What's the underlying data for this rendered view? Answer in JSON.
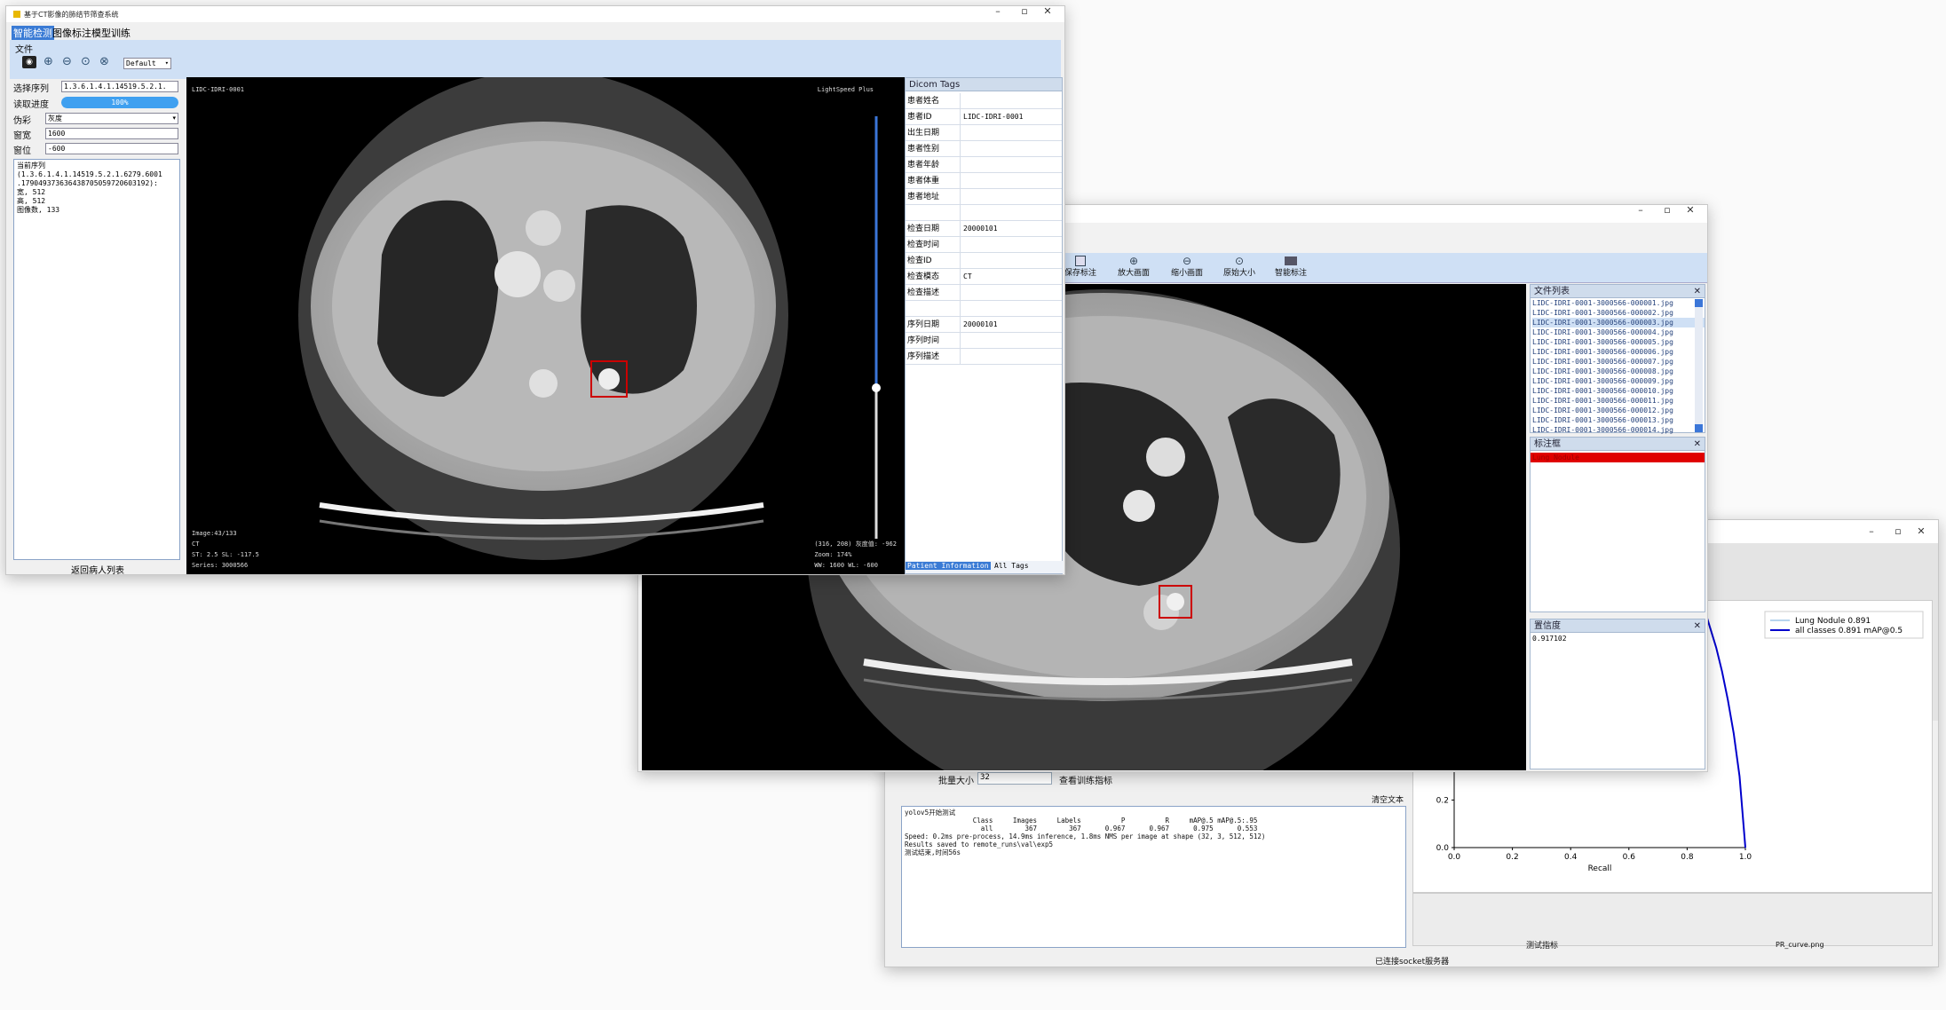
{
  "w1": {
    "title": "基于CT影像的肺结节筛查系统",
    "tabs": [
      "智能检测",
      "图像标注",
      "模型训练"
    ],
    "menu_file": "文件",
    "preset": "Default",
    "select_series_label": "选择序列",
    "select_series_value": "1.3.6.1.4.1.14519.5.2.1.",
    "progress_label": "读取进度",
    "progress_text": "100%",
    "progress_fraction": 1.0,
    "colormap_label": "伪彩",
    "colormap_value": "灰度",
    "ww_label": "窗宽",
    "ww_value": "1600",
    "wl_label": "窗位",
    "wl_value": "-600",
    "info_lines": [
      "当前序列",
      "(1.3.6.1.4.1.14519.5.2.1.6279.6001",
      ".179049373636438705059720603192):",
      "宽, 512",
      "高, 512",
      "图像数, 133"
    ],
    "back_button": "返回病人列表",
    "viewer": {
      "top_left": "LIDC-IDRI-0001",
      "top_right": "LightSpeed Plus",
      "bottom_left": [
        "Image:43/133",
        "CT",
        "ST: 2.5 SL: -117.5",
        "Series: 3000566"
      ],
      "bottom_right": [
        "(316, 208) 灰度值: -962",
        "Zoom: 174%",
        "WW: 1600 WL: -600"
      ]
    },
    "dicom_panel_title": "Dicom Tags",
    "dicom_rows": [
      [
        "患者姓名",
        ""
      ],
      [
        "患者ID",
        "LIDC-IDRI-0001"
      ],
      [
        "出生日期",
        ""
      ],
      [
        "患者性别",
        ""
      ],
      [
        "患者年龄",
        ""
      ],
      [
        "患者体重",
        ""
      ],
      [
        "患者地址",
        ""
      ],
      [
        "",
        ""
      ],
      [
        "检查日期",
        "20000101"
      ],
      [
        "检查时间",
        ""
      ],
      [
        "检查ID",
        ""
      ],
      [
        "检查模态",
        "CT"
      ],
      [
        "检查描述",
        ""
      ],
      [
        "",
        ""
      ],
      [
        "序列日期",
        "20000101"
      ],
      [
        "序列时间",
        ""
      ],
      [
        "序列描述",
        ""
      ]
    ],
    "bottom_tabs": [
      "Patient Information",
      "All Tags"
    ]
  },
  "w2": {
    "toolbar": [
      "保存标注",
      "放大画面",
      "缩小画面",
      "原始大小",
      "智能标注"
    ],
    "file_list_title": "文件列表",
    "files": [
      "LIDC-IDRI-0001-3000566-000001.jpg",
      "LIDC-IDRI-0001-3000566-000002.jpg",
      "LIDC-IDRI-0001-3000566-000003.jpg",
      "LIDC-IDRI-0001-3000566-000004.jpg",
      "LIDC-IDRI-0001-3000566-000005.jpg",
      "LIDC-IDRI-0001-3000566-000006.jpg",
      "LIDC-IDRI-0001-3000566-000007.jpg",
      "LIDC-IDRI-0001-3000566-000008.jpg",
      "LIDC-IDRI-0001-3000566-000009.jpg",
      "LIDC-IDRI-0001-3000566-000010.jpg",
      "LIDC-IDRI-0001-3000566-000011.jpg",
      "LIDC-IDRI-0001-3000566-000012.jpg",
      "LIDC-IDRI-0001-3000566-000013.jpg",
      "LIDC-IDRI-0001-3000566-000014.jpg"
    ],
    "selected_file_index": 2,
    "label_box_title": "标注框",
    "label_box_item": "Lung Nodule",
    "confidence_title": "置信度",
    "confidence_value": "0.917102"
  },
  "w3": {
    "batch_label": "批量大小",
    "batch_value": "32",
    "view_metrics_button": "查看训练指标",
    "clear_text_button": "清空文本",
    "log_lines": [
      "yolov5开始测试",
      "                 Class     Images     Labels          P          R     mAP@.5 mAP@.5:.95",
      "                   all        367        367      0.967      0.967      0.975      0.553",
      "Speed: 0.2ms pre-process, 14.9ms inference, 1.8ms NMS per image at shape (32, 3, 512, 512)",
      "Results saved to remote_runs\\val\\exp5",
      "测试结束,时间56s"
    ],
    "status_text": "已连接socket服务器",
    "bottom_tabs": [
      "测试指标",
      "PR_curve.png"
    ]
  },
  "chart_data": {
    "type": "line",
    "xlabel": "Recall",
    "ylabel": "",
    "xlim": [
      0.0,
      1.0
    ],
    "x_ticks": [
      "0.0",
      "0.2",
      "0.4",
      "0.6",
      "0.8",
      "1.0"
    ],
    "y_ticks": [
      "0.0",
      "0.2"
    ],
    "legend": "top-right",
    "series": [
      {
        "name": "Lung Nodule 0.891",
        "color": "#6fa8dc",
        "x": [
          0.86,
          0.88,
          0.9,
          0.92,
          0.94,
          0.96,
          0.98,
          1.0
        ],
        "y": [
          1.0,
          0.92,
          0.84,
          0.74,
          0.62,
          0.48,
          0.3,
          0.0
        ]
      },
      {
        "name": "all classes 0.891 mAP@0.5",
        "color": "#0000cc",
        "x": [
          0.86,
          0.88,
          0.9,
          0.92,
          0.94,
          0.96,
          0.98,
          1.0
        ],
        "y": [
          1.0,
          0.92,
          0.84,
          0.74,
          0.62,
          0.48,
          0.3,
          0.0
        ]
      }
    ]
  }
}
